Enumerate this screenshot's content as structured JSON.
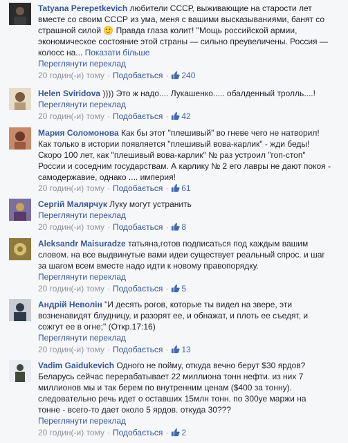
{
  "comments": [
    {
      "author": "Tatyana Perepetkevich",
      "lines": [
        "любители СССР, выживающие на старости лет",
        "вместе со своим СССР из ума, меня с вашими высказываниями, банят со",
        "страшной силой 🙂 Правда глаза колит! \"Мощь российской армии,",
        "экономическое состояние этой страны — сильно преувеличены. Россия —",
        "колосс на..."
      ],
      "more": "Показати більше",
      "translate": "Переглянути переклад",
      "time": "20 годин(-и) тому",
      "like": "Подобається",
      "likes": "240",
      "avatar_colors": [
        "#2b2b2b",
        "#6f5a4a"
      ]
    },
    {
      "author": "Helen Sviridova",
      "lines": [
        ")))) Это ж надо.... Лукашенко..... обалденный тролль....!"
      ],
      "translate": "Переглянути переклад",
      "time": "20 годин(-и) тому",
      "like": "Подобається",
      "likes": "42",
      "avatar_colors": [
        "#e6dcc8",
        "#7a5b3c"
      ]
    },
    {
      "author": "Мария Соломонова",
      "lines": [
        "Как бы этот \"плешивый\" во гневе чего не натворил!",
        "Как только в истории появляется \"плешивый вова-карлик\" - жди беды!",
        "Скоро 100 лет, как \"плешивый вова-карлик\" № раз устроил \"гоп-стоп\"",
        "России и соседним государствам. А карлику № 2 его лавры не дают покоя -",
        "самодержавие, однако .... империя!"
      ],
      "time": "20 годин(-и) тому",
      "like": "Подобається",
      "likes": "61",
      "avatar_colors": [
        "#c98a6a",
        "#6a3b2a"
      ]
    },
    {
      "author": "Сергій Малярчук",
      "lines": [
        "Луку могут устранить"
      ],
      "translate": "Переглянути переклад",
      "time": "20 годин(-и) тому",
      "like": "Подобається",
      "likes": "8",
      "avatar_colors": [
        "#7a6fa0",
        "#c8a35a"
      ]
    },
    {
      "author": "Aleksandr Maisuradze",
      "lines": [
        "татьяна,готов подписаться под каждым вашим",
        "словом. на все выдвинутые вами идеи существует реальный спрос. и шаг",
        "за шагом всем вместе надо идти к новому правопорядку."
      ],
      "translate": "Переглянути переклад",
      "time": "20 годин(-и) тому",
      "like": "Подобається",
      "likes": "5",
      "avatar_colors": [
        "#8e7a3e",
        "#d7c070"
      ]
    },
    {
      "author": "Андрій Неволін",
      "lines": [
        "\"И десять рогов, которые ты видел на звере, эти",
        "возненавидят блудницу, и разорят ее, и обнажат, и плоть ее съедят, и",
        "сожгут ее в огне;\" (Откр.17:16)"
      ],
      "translate": "Переглянути переклад",
      "time": "20 годин(-и) тому",
      "like": "Подобається",
      "likes": "13",
      "avatar_colors": [
        "#c9ccd2",
        "#2d3a4a"
      ]
    },
    {
      "author": "Vadim Gaidukevich",
      "lines": [
        "Одного не пойму, откуда вечно берут $30 ярдов?",
        "Беларусь сейчас перерабатывает 22 миллиона тонн нефти. из них 7",
        "миллионов мы и так берем по внутренним ценам ($400 за тонну).",
        "следовательно речь идет о оставших 15млн тонн. по 300уе маржи на",
        "тонне - всего-то дает около 5 ярдов. откуда 30???"
      ],
      "translate": "Переглянути переклад",
      "time": "20 годин(-и) тому",
      "like": "Подобається",
      "likes": "2",
      "avatar_colors": [
        "#e9edf2",
        "#3f4b3a"
      ]
    }
  ]
}
